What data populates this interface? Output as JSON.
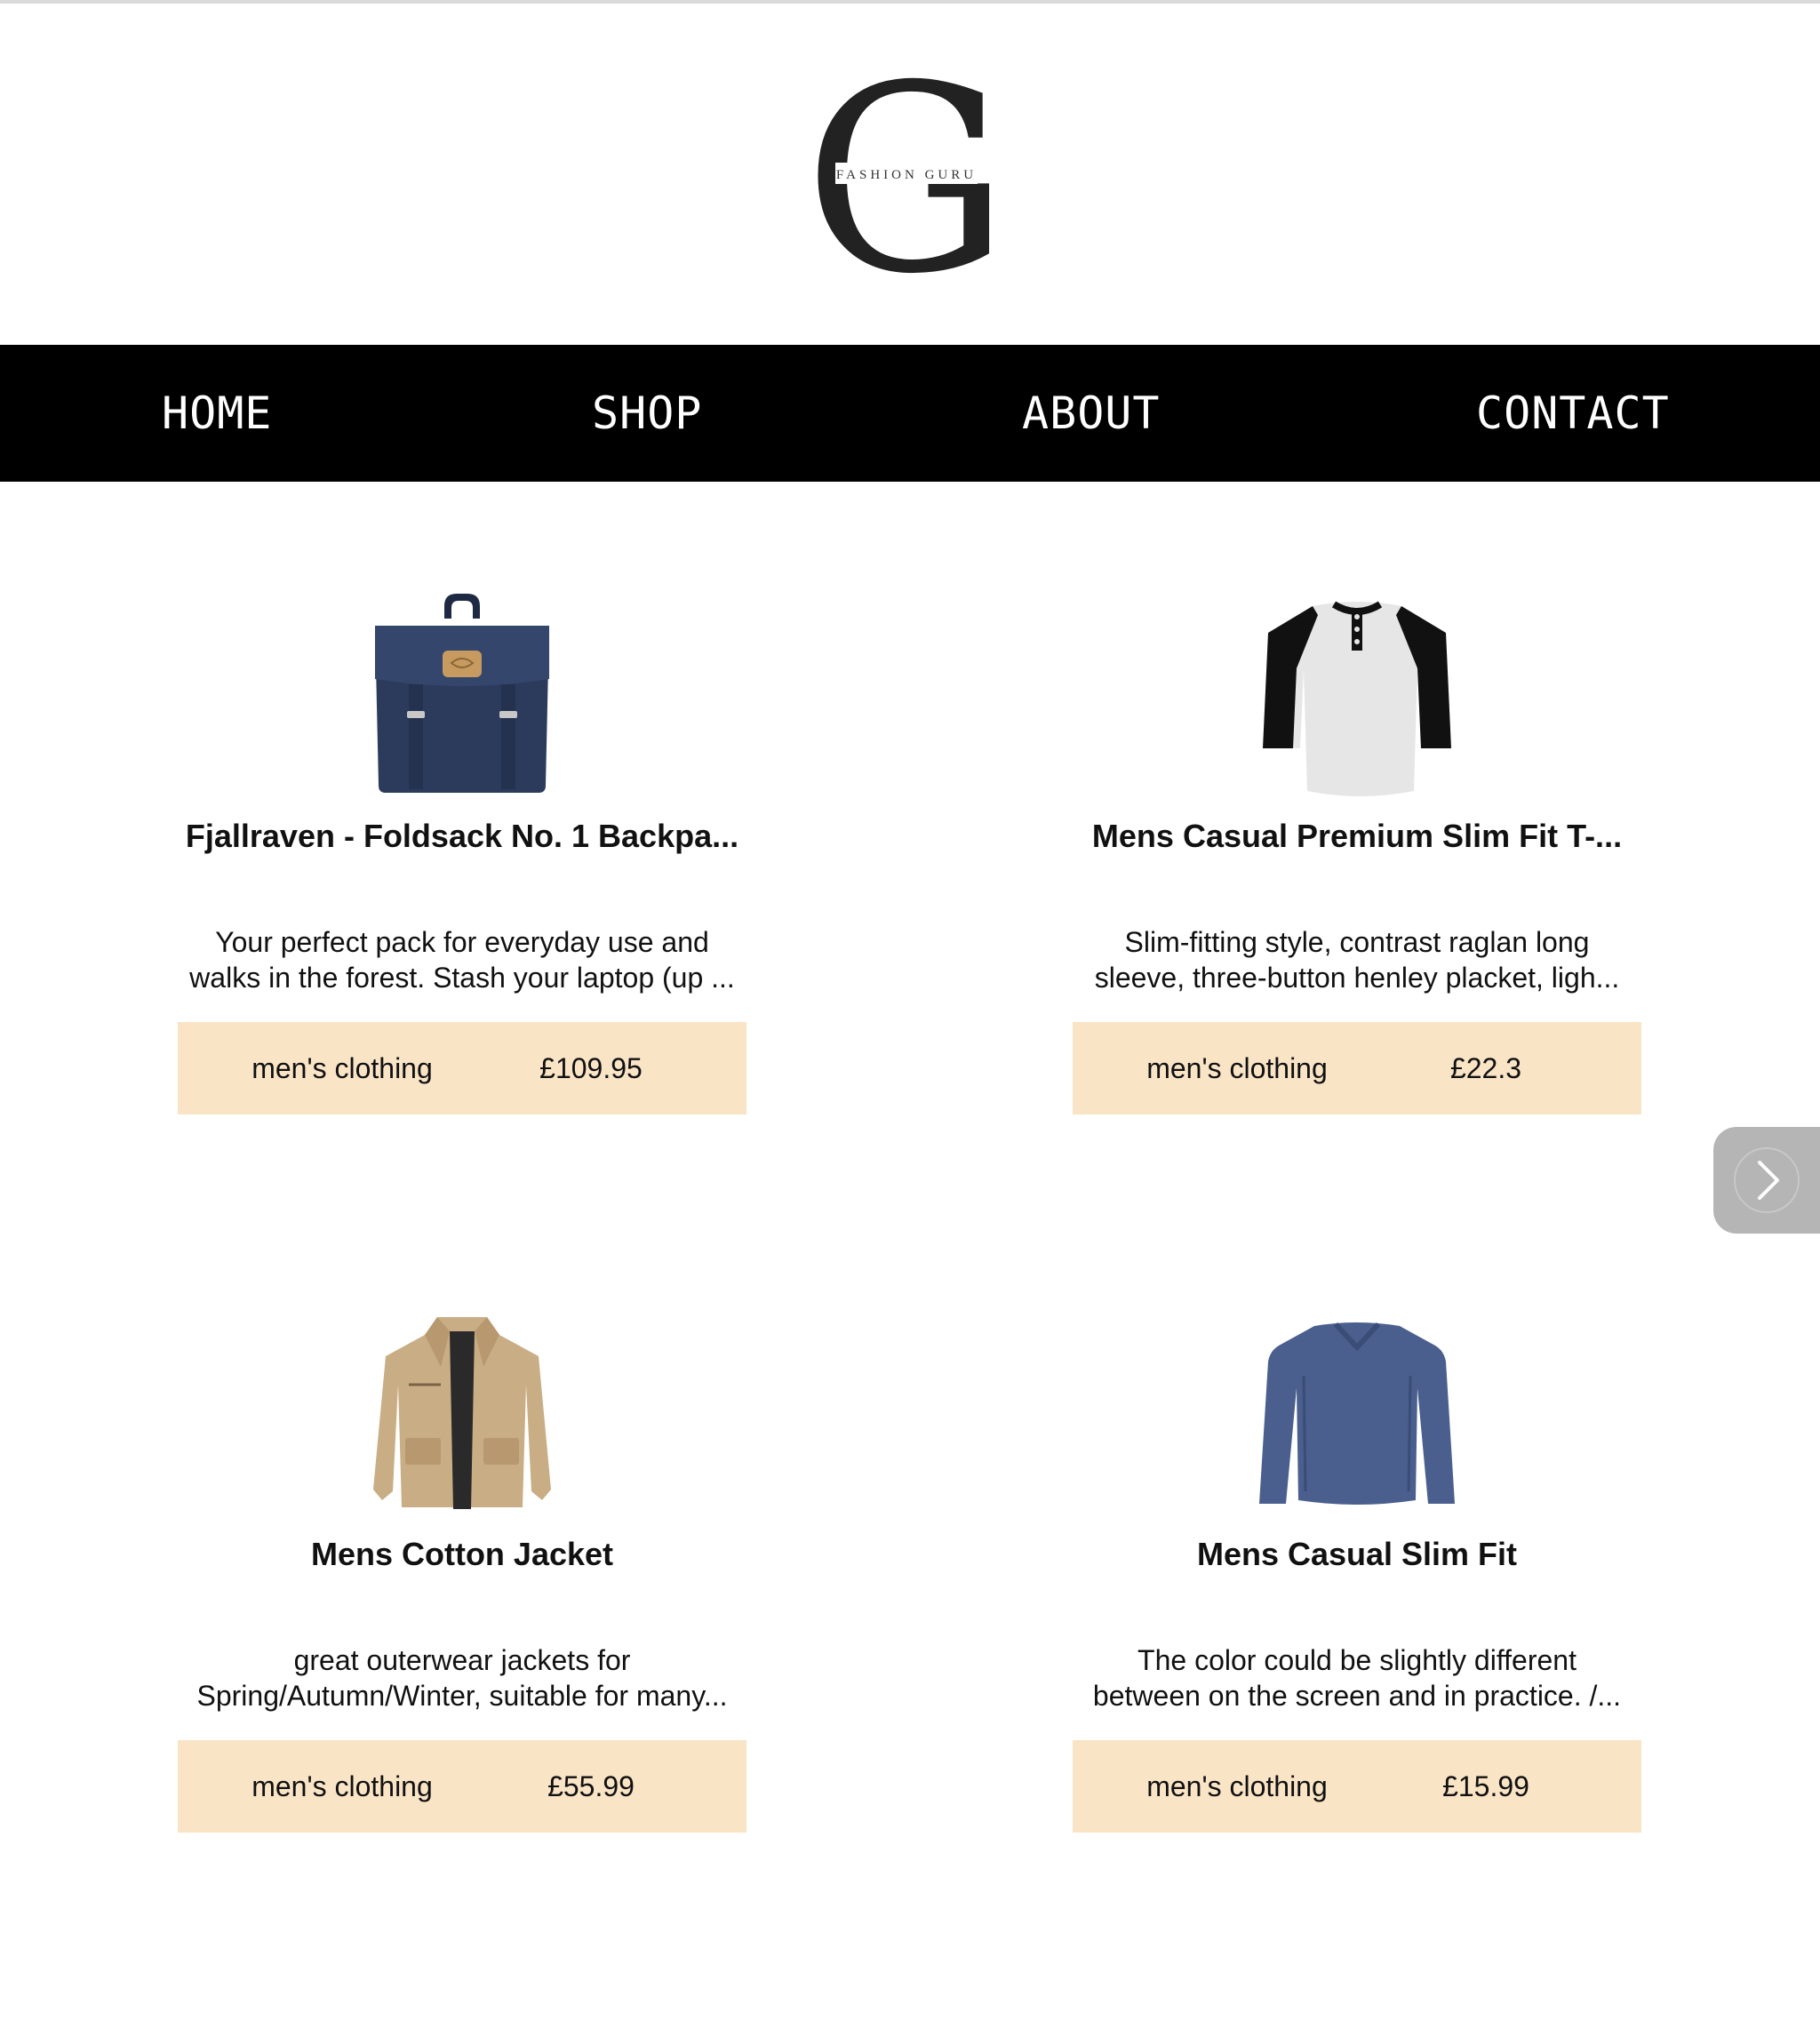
{
  "brand": {
    "logo_letter": "G",
    "logo_text": "FASHION GURU"
  },
  "nav": {
    "items": [
      {
        "label": "HOME"
      },
      {
        "label": "SHOP"
      },
      {
        "label": "ABOUT"
      },
      {
        "label": "CONTACT"
      }
    ]
  },
  "products": [
    {
      "title": "Fjallraven - Foldsack No. 1 Backpa...",
      "description_line1": "Your perfect pack for everyday use and",
      "description_line2": "walks in the forest. Stash your laptop (up ...",
      "category": "men's clothing",
      "price": "£109.95",
      "image_icon": "backpack-image"
    },
    {
      "title": "Mens Casual Premium Slim Fit T-...",
      "description_line1": "Slim-fitting style, contrast raglan long",
      "description_line2": "sleeve, three-button henley placket, ligh...",
      "category": "men's clothing",
      "price": "£22.3",
      "image_icon": "henley-shirt-image"
    },
    {
      "title": "Mens Cotton Jacket",
      "description_line1": "great outerwear jackets for",
      "description_line2": "Spring/Autumn/Winter, suitable for many...",
      "category": "men's clothing",
      "price": "£55.99",
      "image_icon": "jacket-image"
    },
    {
      "title": "Mens Casual Slim Fit",
      "description_line1": "The color could be slightly different",
      "description_line2": "between on the screen and in practice. /...",
      "category": "men's clothing",
      "price": "£15.99",
      "image_icon": "long-sleeve-shirt-image"
    }
  ],
  "colors": {
    "nav_background": "#000000",
    "nav_text": "#ffffff",
    "meta_background": "#f9e4c6",
    "next_button_background": "#b5b5b5"
  },
  "next_button": {
    "icon": "chevron-right-icon"
  }
}
